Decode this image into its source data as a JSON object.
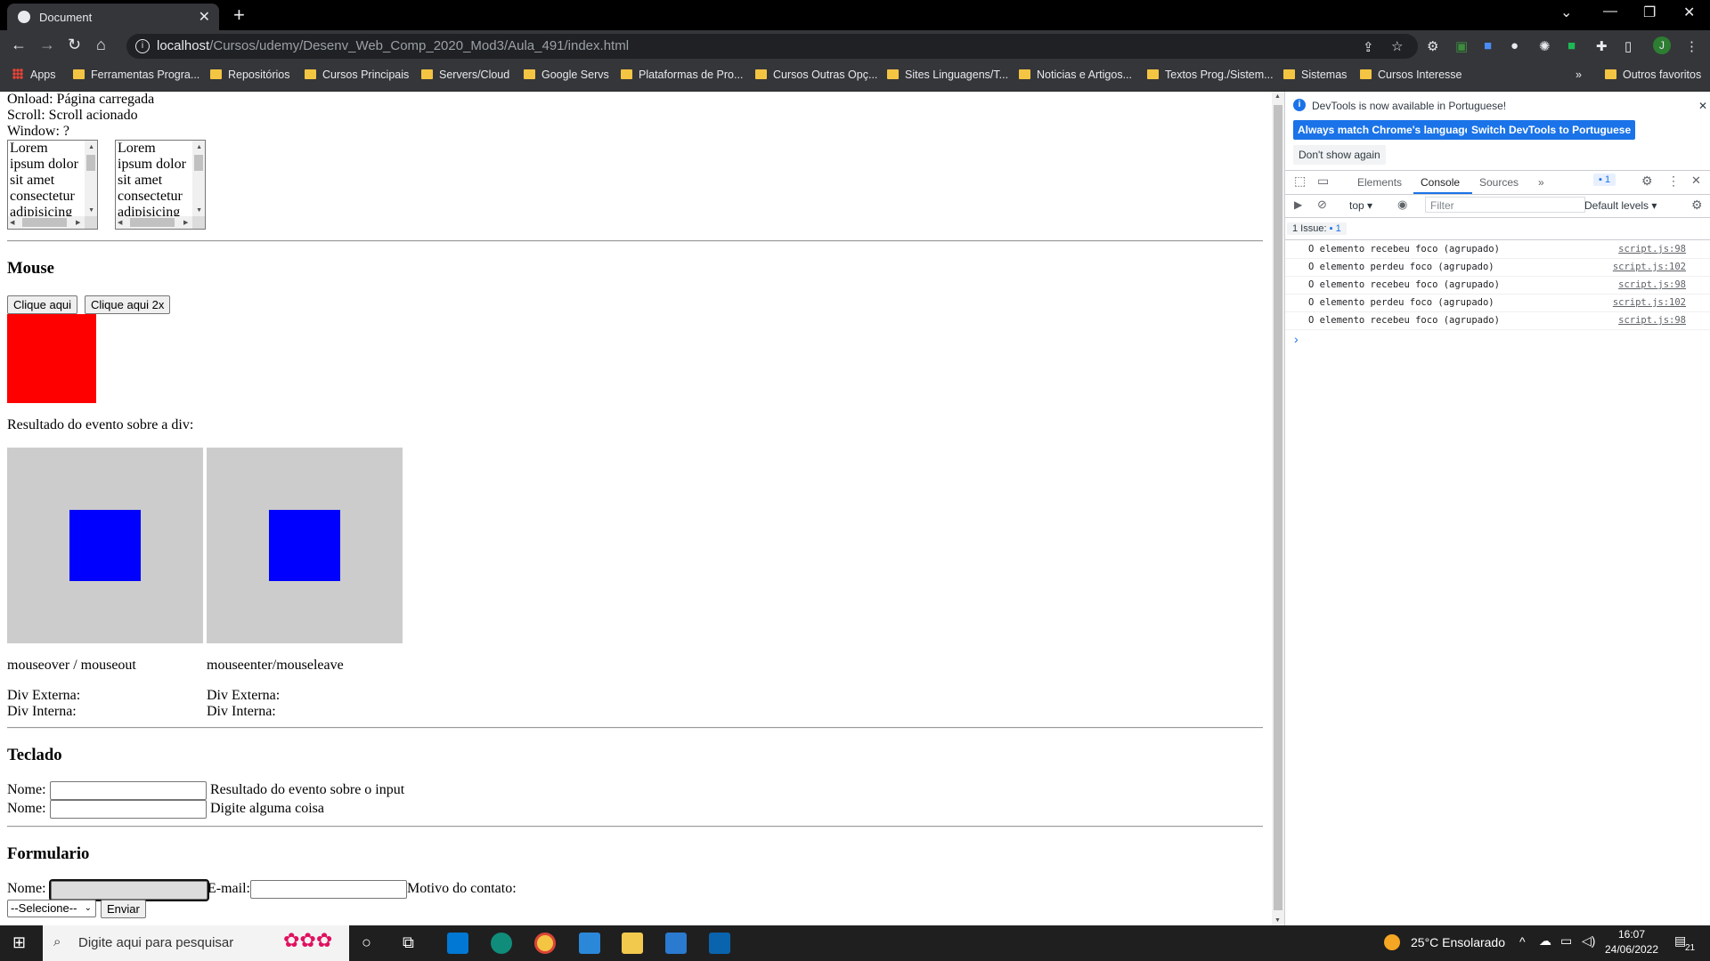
{
  "browser": {
    "tab_title": "Document",
    "tab_close": "✕",
    "new_tab": "+",
    "url_host": "localhost",
    "url_path": "/Cursos/udemy/Desenv_Web_Comp_2020_Mod3/Aula_491/index.html",
    "bookmarks": [
      "Apps",
      "Ferramentas Progra...",
      "Repositórios",
      "Cursos Principais",
      "Servers/Cloud",
      "Google Servs",
      "Plataformas de Pro...",
      "Cursos Outras Opç...",
      "Sites Linguagens/T...",
      "Noticias e Artigos...",
      "Textos Prog./Sistem...",
      "Sistemas",
      "Cursos Interesse"
    ],
    "bookmarks_more": "»",
    "other_bookmarks": "Outros favoritos",
    "profile_initial": "J"
  },
  "page": {
    "onload": "Onload: Página carregada",
    "scroll": "Scroll: Scroll acionado",
    "window": "Window: ?",
    "scrollbox_text": "Lorem ipsum dolor sit amet consectetur adipisicing",
    "mouse_heading": "Mouse",
    "click_button": "Clique aqui",
    "dblclick_button": "Clique aqui 2x",
    "result_label": "Resultado do evento sobre a div:",
    "label_over": "mouseover / mouseout",
    "label_enter": "mouseenter/mouseleave",
    "div_externa": "Div Externa:",
    "div_interna": "Div Interna:",
    "teclado_heading": "Teclado",
    "nome_label": "Nome:",
    "result_input": "Resultado do evento sobre o input",
    "digite": "Digite alguma coisa",
    "form_heading": "Formulario",
    "email_label": "E-mail:",
    "motivo_label": "Motivo do contato:",
    "select_value": "--Selecione--",
    "enviar_button": "Enviar"
  },
  "devtools": {
    "banner_text": "DevTools is now available in Portuguese!",
    "btn_match": "Always match Chrome's language",
    "btn_switch": "Switch DevTools to Portuguese",
    "btn_dont_show": "Don't show again",
    "tabs": [
      "Elements",
      "Console",
      "Sources"
    ],
    "active_tab": "Console",
    "issues_badge": "1",
    "context": "top",
    "filter_placeholder": "Filter",
    "levels": "Default levels",
    "issues_bar": "1 Issue:",
    "issues_count": "1",
    "logs": [
      {
        "msg": "O elemento recebeu foco (agrupado)",
        "src": "script.js:98"
      },
      {
        "msg": "O elemento perdeu foco (agrupado)",
        "src": "script.js:102"
      },
      {
        "msg": "O elemento recebeu foco (agrupado)",
        "src": "script.js:98"
      },
      {
        "msg": "O elemento perdeu foco (agrupado)",
        "src": "script.js:102"
      },
      {
        "msg": "O elemento recebeu foco (agrupado)",
        "src": "script.js:98"
      }
    ],
    "prompt": "›"
  },
  "taskbar": {
    "search_placeholder": "Digite aqui para pesquisar",
    "weather": "25°C  Ensolarado",
    "time": "16:07",
    "date": "24/06/2022",
    "notif_count": "21"
  },
  "colors": {
    "red_box": "#ff0000",
    "blue_inner": "#0000ff",
    "gray_outer": "#cccccc",
    "devtools_accent": "#1a73e8"
  }
}
